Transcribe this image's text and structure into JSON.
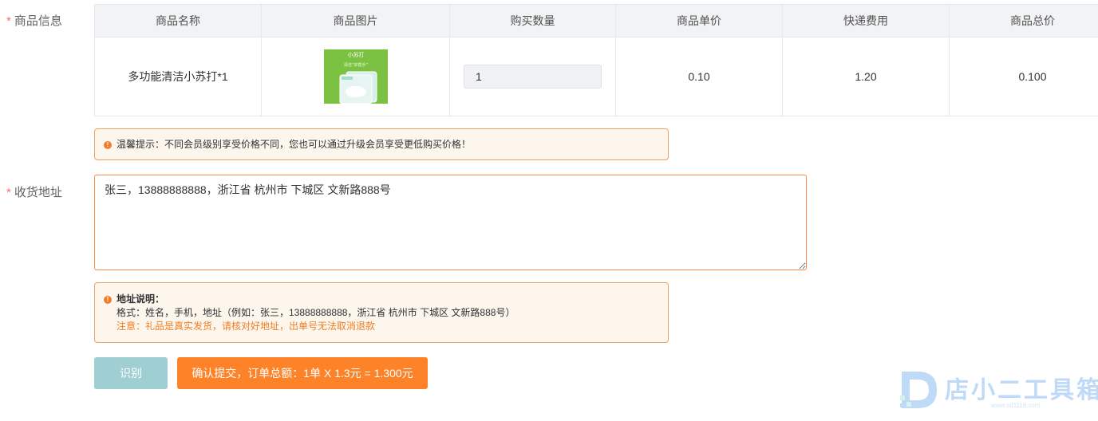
{
  "product_section": {
    "label": "商品信息",
    "headers": [
      "商品名称",
      "商品图片",
      "购买数量",
      "商品单价",
      "快递费用",
      "商品总价"
    ],
    "row": {
      "name": "多功能清洁小苏打*1",
      "image_icon": "baking-soda-package",
      "image_text_top": "小苏打",
      "image_text_sub": "清洁“好帮手”",
      "quantity": "1",
      "unit_price": "0.10",
      "shipping": "1.20",
      "total": "0.100"
    }
  },
  "tip_notice": {
    "icon": "exclamation-circle-icon",
    "text": "温馨提示：不同会员级别享受价格不同，您也可以通过升级会员享受更低购买价格！"
  },
  "address_section": {
    "label": "收货地址",
    "value": "张三，13888888888，浙江省 杭州市 下城区 文新路888号"
  },
  "address_notice": {
    "title": "地址说明：",
    "format": "格式：姓名，手机，地址（例如：张三，13888888888，浙江省 杭州市 下城区 文新路888号）",
    "warning": "注意：礼品是真实发货，请核对好地址，出单号无法取消退款"
  },
  "buttons": {
    "recognize": "识别",
    "submit": "确认提交，订单总额：1单 X 1.3元 = 1.300元"
  },
  "watermark": {
    "text": "店小二工具箱",
    "url": "www.sd1118.com"
  },
  "colors": {
    "accent_orange": "#fd8228",
    "recognize_button": "#a0cfd3",
    "required_star": "#f56c6c",
    "warning_text": "#f07e26",
    "notice_bg": "#fdf6ec"
  }
}
